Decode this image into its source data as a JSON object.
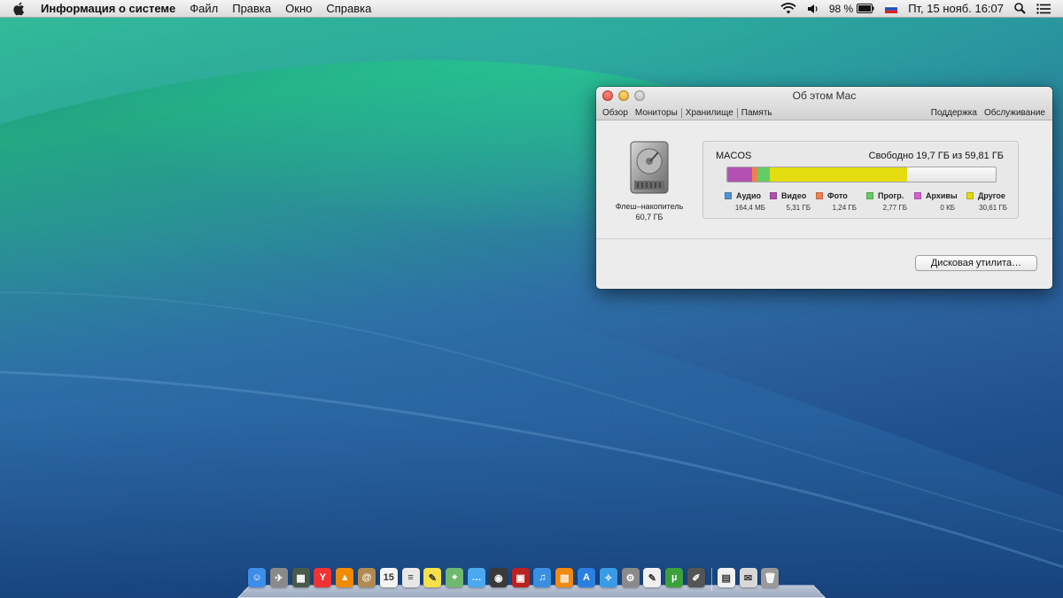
{
  "menubar": {
    "apple_icon": "apple-icon",
    "app_name": "Информация о системе",
    "menus": [
      "Файл",
      "Правка",
      "Окно",
      "Справка"
    ],
    "status": {
      "battery_percent": "98 %",
      "datetime": "Пт, 15 нояб.  16:07"
    }
  },
  "window": {
    "title": "Об этом Mac",
    "tabs": [
      "Обзор",
      "Мониторы",
      "Хранилище",
      "Память"
    ],
    "active_tab": "Хранилище",
    "links": [
      "Поддержка",
      "Обслуживание"
    ],
    "drive": {
      "name": "Флеш–накопитель",
      "size": "60,7 ГБ"
    },
    "volume": {
      "name": "MACOS",
      "free_text": "Свободно 19,7 ГБ из 59,81 ГБ",
      "usage": [
        {
          "label": "Аудио",
          "value": "164,4 МБ",
          "fraction": 0.003,
          "color": "#4f94d4"
        },
        {
          "label": "Видео",
          "value": "5,31 ГБ",
          "fraction": 0.089,
          "color": "#b44fb4"
        },
        {
          "label": "Фото",
          "value": "1,24 ГБ",
          "fraction": 0.021,
          "color": "#f08050"
        },
        {
          "label": "Прогр.",
          "value": "2,77 ГБ",
          "fraction": 0.046,
          "color": "#63cc63"
        },
        {
          "label": "Архивы",
          "value": "0 КБ",
          "fraction": 0.0,
          "color": "#d65fd6"
        },
        {
          "label": "Другое",
          "value": "30,61 ГБ",
          "fraction": 0.512,
          "color": "#e3dc10"
        }
      ]
    },
    "disk_utility_button": "Дисковая утилита…"
  },
  "dock": {
    "apps": [
      {
        "name": "finder-icon",
        "glyph": "☺",
        "color": "#3d8ee8"
      },
      {
        "name": "launchpad-icon",
        "glyph": "✈",
        "color": "#8a8a8a"
      },
      {
        "name": "mission-control-icon",
        "glyph": "▦",
        "color": "#4a5a4a"
      },
      {
        "name": "yandex-browser-icon",
        "glyph": "Y",
        "color": "#e33"
      },
      {
        "name": "vlc-icon",
        "glyph": "▲",
        "color": "#f08a00"
      },
      {
        "name": "contacts-icon",
        "glyph": "@",
        "color": "#b08a50"
      },
      {
        "name": "calendar-icon",
        "glyph": "15",
        "color": "#f4f4f4"
      },
      {
        "name": "notes-icon",
        "glyph": "≡",
        "color": "#e8e8e8"
      },
      {
        "name": "stickies-icon",
        "glyph": "✎",
        "color": "#f5e04a"
      },
      {
        "name": "maps-icon",
        "glyph": "⌖",
        "color": "#6fb86f"
      },
      {
        "name": "messages-icon",
        "glyph": "…",
        "color": "#4aa8f0"
      },
      {
        "name": "facetime-icon",
        "glyph": "◉",
        "color": "#3a3a3a"
      },
      {
        "name": "photo-booth-icon",
        "glyph": "▣",
        "color": "#b22"
      },
      {
        "name": "itunes-icon",
        "glyph": "♫",
        "color": "#3a8fe0"
      },
      {
        "name": "ibooks-icon",
        "glyph": "▤",
        "color": "#f08a10"
      },
      {
        "name": "app-store-icon",
        "glyph": "A",
        "color": "#2a7fe0"
      },
      {
        "name": "safari-icon",
        "glyph": "✧",
        "color": "#3a9ae6"
      },
      {
        "name": "system-preferences-icon",
        "glyph": "⚙",
        "color": "#8a8a8a"
      },
      {
        "name": "textedit-icon",
        "glyph": "✎",
        "color": "#f0f0f0"
      },
      {
        "name": "utorrent-icon",
        "glyph": "µ",
        "color": "#3ca03c"
      },
      {
        "name": "script-editor-icon",
        "glyph": "✐",
        "color": "#555"
      },
      {
        "name": "document-icon",
        "glyph": "▤",
        "color": "#f0f0f0"
      },
      {
        "name": "mail-icon",
        "glyph": "✉",
        "color": "#d8d8d8"
      },
      {
        "name": "trash-icon",
        "glyph": "🗑",
        "color": "#9a9a9a"
      }
    ]
  }
}
